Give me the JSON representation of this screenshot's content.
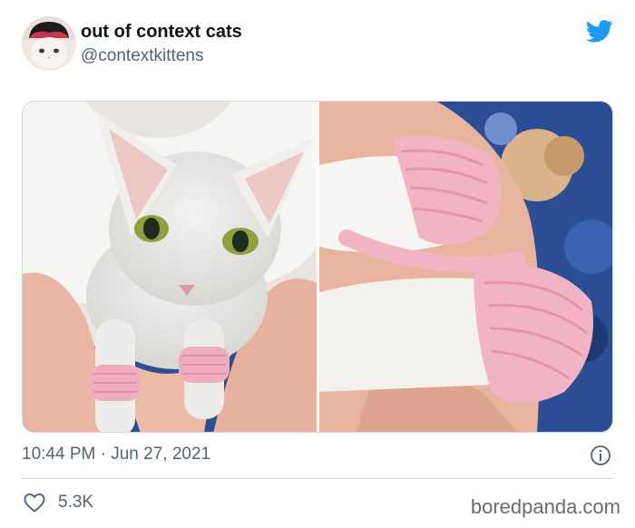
{
  "author": {
    "display_name": "out of context cats",
    "handle": "@contextkittens",
    "avatar_icon": "cat-avatar"
  },
  "brand": {
    "logo_icon": "twitter-bird-icon",
    "color": "#1d9bf0"
  },
  "media": {
    "photos": [
      {
        "subject": "white-cat-in-hands-wearing-pink-crochet-paw-cuffs"
      },
      {
        "subject": "closeup-cat-paws-with-pink-crochet-slippers"
      }
    ]
  },
  "meta": {
    "timestamp": "10:44 PM · Jun 27, 2021",
    "info_icon": "info-icon"
  },
  "actions": {
    "like_icon": "heart-icon",
    "like_count": "5.3K"
  },
  "watermark": "boredpanda.com"
}
